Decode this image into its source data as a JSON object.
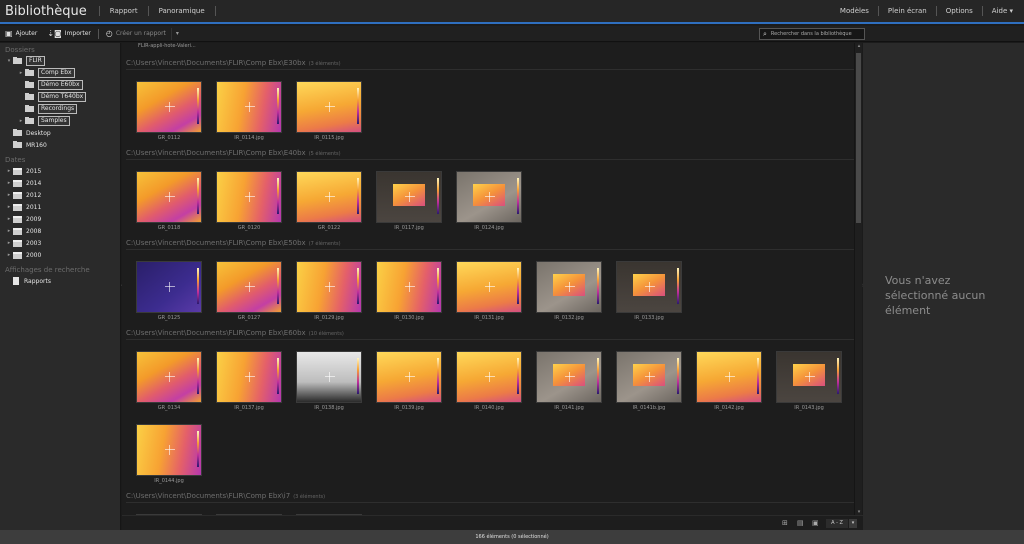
{
  "app_title": "Bibliothèque",
  "menu": {
    "left": [
      "Rapport",
      "Panoramique"
    ],
    "right": [
      "Modèles",
      "Plein écran",
      "Options",
      "Aide ▾"
    ]
  },
  "toolbar": {
    "add": "Ajouter",
    "import": "Importer",
    "create_report": "Créer un rapport",
    "search_placeholder": "Rechercher dans la bibliothèque"
  },
  "sidebar": {
    "folders_head": "Dossiers",
    "folders": [
      {
        "label": "FLIR",
        "level": 0,
        "expanded": true,
        "boxed": true
      },
      {
        "label": "Comp Ebx",
        "level": 1,
        "expanded": false,
        "boxed": true
      },
      {
        "label": "Démo E60bx",
        "level": 1,
        "boxed": true
      },
      {
        "label": "Démo T640bx",
        "level": 1,
        "boxed": true
      },
      {
        "label": "Recordings",
        "level": 1,
        "boxed": true
      },
      {
        "label": "Samples",
        "level": 1,
        "expanded": false,
        "boxed": true
      },
      {
        "label": "Desktop",
        "level": 0
      },
      {
        "label": "MR160",
        "level": 0
      }
    ],
    "dates_head": "Dates",
    "dates": [
      "2015",
      "2014",
      "2012",
      "2011",
      "2009",
      "2008",
      "2003",
      "2000"
    ],
    "search_head": "Affichages de recherche",
    "searches": [
      "Rapports"
    ]
  },
  "main": {
    "top_path": "FLIR-appli-hote-Valeri...",
    "groups": [
      {
        "path": "C:\\Users\\Vincent\\Documents\\FLIR\\Comp Ebx\\E30bx",
        "count": "(3 éléments)",
        "items": [
          {
            "label": "GR_0112",
            "style": "th-a"
          },
          {
            "label": "IR_0114.jpg",
            "style": "th-b"
          },
          {
            "label": "IR_0115.jpg",
            "style": "th-c"
          }
        ]
      },
      {
        "path": "C:\\Users\\Vincent\\Documents\\FLIR\\Comp Ebx\\E40bx",
        "count": "(5 éléments)",
        "items": [
          {
            "label": "GR_0118",
            "style": "th-a"
          },
          {
            "label": "GR_0120",
            "style": "th-b"
          },
          {
            "label": "GR_0122",
            "style": "th-c"
          },
          {
            "label": "IR_0117.jpg",
            "style": "th-dark"
          },
          {
            "label": "IR_0124.jpg",
            "style": "th-gray"
          }
        ]
      },
      {
        "path": "C:\\Users\\Vincent\\Documents\\FLIR\\Comp Ebx\\E50bx",
        "count": "(7 éléments)",
        "items": [
          {
            "label": "GR_0125",
            "style": "th-blue"
          },
          {
            "label": "GR_0127",
            "style": "th-a"
          },
          {
            "label": "IR_0129.jpg",
            "style": "th-b"
          },
          {
            "label": "IR_0130.jpg",
            "style": "th-b"
          },
          {
            "label": "IR_0131.jpg",
            "style": "th-c"
          },
          {
            "label": "IR_0132.jpg",
            "style": "th-gray"
          },
          {
            "label": "IR_0133.jpg",
            "style": "th-dark"
          }
        ]
      },
      {
        "path": "C:\\Users\\Vincent\\Documents\\FLIR\\Comp Ebx\\E60bx",
        "count": "(10 éléments)",
        "items": [
          {
            "label": "GR_0134",
            "style": "th-a"
          },
          {
            "label": "IR_0137.jpg",
            "style": "th-b"
          },
          {
            "label": "IR_0138.jpg",
            "style": "th-bw"
          },
          {
            "label": "IR_0139.jpg",
            "style": "th-c"
          },
          {
            "label": "IR_0140.jpg",
            "style": "th-c"
          },
          {
            "label": "IR_0141.jpg",
            "style": "th-gray"
          },
          {
            "label": "IR_0141b.jpg",
            "style": "th-gray"
          },
          {
            "label": "IR_0142.jpg",
            "style": "th-c"
          },
          {
            "label": "IR_0143.jpg",
            "style": "th-dark"
          },
          {
            "label": "IR_0144.jpg",
            "style": "th-b"
          }
        ]
      },
      {
        "path": "C:\\Users\\Vincent\\Documents\\FLIR\\Comp Ebx\\i7",
        "count": "(3 éléments)",
        "items": []
      }
    ]
  },
  "right_panel": {
    "message": "Vous n'avez sélectionné aucun élément"
  },
  "viewbar": {
    "sort": "A - Z"
  },
  "status": {
    "text": "166 éléments   (0 sélectionné)"
  },
  "colors": {
    "accent": "#2f6fbf",
    "background": "#1b1b1b",
    "panel": "#2a2a2a"
  }
}
